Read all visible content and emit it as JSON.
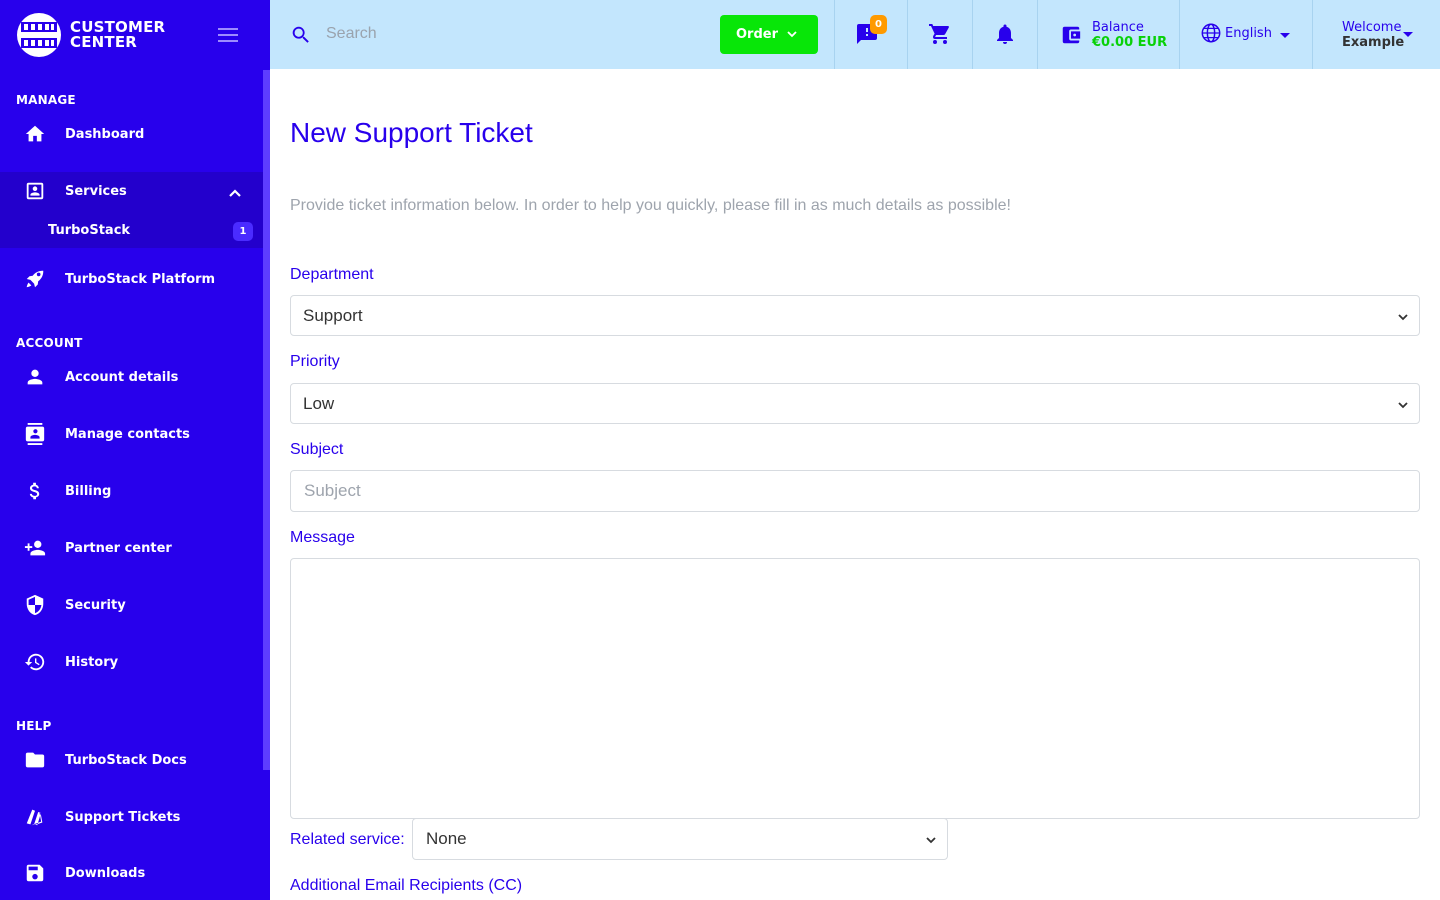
{
  "brand": {
    "line1": "CUSTOMER",
    "line2": "CENTER"
  },
  "sidebar": {
    "sections": {
      "manage": "MANAGE",
      "account": "ACCOUNT",
      "help": "HELP"
    },
    "items": [
      {
        "label": "Dashboard",
        "icon": "home-icon"
      },
      {
        "label": "Services",
        "icon": "contact-card-icon"
      },
      {
        "label": "TurboStack",
        "badge": "1"
      },
      {
        "label": "TurboStack Platform",
        "icon": "rocket-icon"
      },
      {
        "label": "Account details",
        "icon": "user-icon"
      },
      {
        "label": "Manage contacts",
        "icon": "contacts-book-icon"
      },
      {
        "label": "Billing",
        "icon": "dollar-icon"
      },
      {
        "label": "Partner center",
        "icon": "add-user-icon"
      },
      {
        "label": "Security",
        "icon": "shield-icon"
      },
      {
        "label": "History",
        "icon": "history-icon"
      },
      {
        "label": "TurboStack Docs",
        "icon": "folder-icon"
      },
      {
        "label": "Support Tickets",
        "icon": "ticket-icon"
      },
      {
        "label": "Downloads",
        "icon": "save-icon"
      }
    ]
  },
  "topbar": {
    "search_placeholder": "Search",
    "order_label": "Order",
    "messages_badge": "0",
    "balance_label": "Balance",
    "balance_value": "€0.00 EUR",
    "language": "English",
    "welcome_label": "Welcome",
    "welcome_name": "Example"
  },
  "colors": {
    "primary": "#2800ec",
    "accent_green": "#08e608",
    "topbar": "#c3e6fd",
    "badge_orange": "#ff9a00"
  },
  "form": {
    "title": "New Support Ticket",
    "intro": "Provide ticket information below. In order to help you quickly, please fill in as much details as possible!",
    "department_label": "Department",
    "department_value": "Support",
    "priority_label": "Priority",
    "priority_value": "Low",
    "subject_label": "Subject",
    "subject_placeholder": "Subject",
    "message_label": "Message",
    "related_label": "Related service:",
    "related_value": "None",
    "cc_label": "Additional Email Recipients (CC)"
  }
}
